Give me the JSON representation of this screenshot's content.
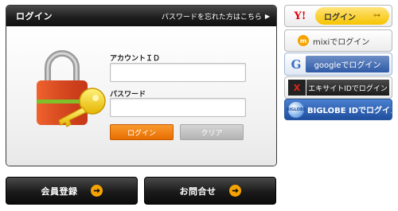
{
  "login_panel": {
    "title": "ログイン",
    "forgot_password": "パスワードを忘れた方はこちら",
    "account_id_label": "アカウントＩＤ",
    "account_id_value": "",
    "password_label": "パスワード",
    "password_value": "",
    "login_button": "ログイン",
    "clear_button": "クリア"
  },
  "bottom_buttons": {
    "register": "会員登録",
    "contact": "お問合せ"
  },
  "social_login": {
    "yahoo_mark": "Y!",
    "yahoo_label": "ログイン",
    "mixi_mark": "m",
    "mixi_label": "mixiでログイン",
    "google_mark": "G",
    "google_label": "googleでログイン",
    "excite_mark": "X",
    "excite_label": "エキサイトIDでログイン",
    "biglobe_mark": "BIGLOBE",
    "biglobe_label": "BIGLOBE IDでログイン"
  },
  "icons": {
    "illustration": "lock-key-illustration",
    "arrow": "arrow-circle-icon",
    "forgot": "triangle-right-icon"
  },
  "colors": {
    "header_dark": "#1c1c1c",
    "accent_orange": "#f5a300",
    "login_orange": "#e86d00",
    "clear_gray": "#b3b3b3",
    "yahoo_red": "#e60012",
    "google_blue": "#2f5aa6",
    "biglobe_blue": "#1f4f9e"
  }
}
